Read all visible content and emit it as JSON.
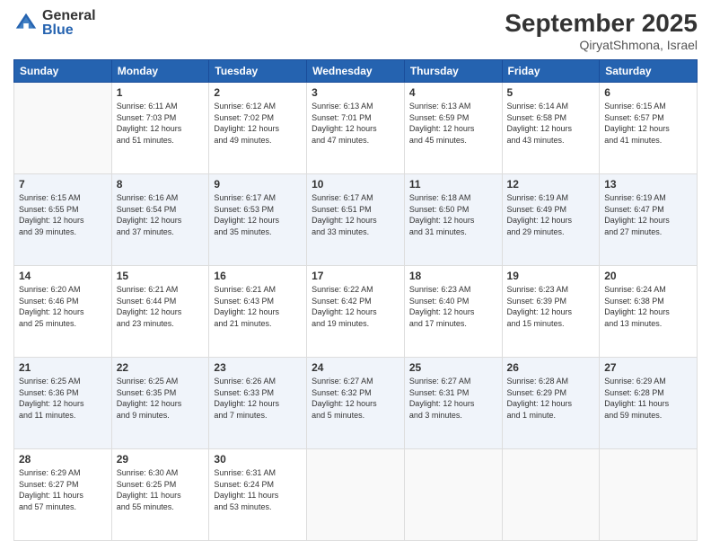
{
  "logo": {
    "general": "General",
    "blue": "Blue"
  },
  "title": "September 2025",
  "subtitle": "QiryatShmona, Israel",
  "days_header": [
    "Sunday",
    "Monday",
    "Tuesday",
    "Wednesday",
    "Thursday",
    "Friday",
    "Saturday"
  ],
  "weeks": [
    [
      {
        "day": "",
        "info": ""
      },
      {
        "day": "1",
        "info": "Sunrise: 6:11 AM\nSunset: 7:03 PM\nDaylight: 12 hours\nand 51 minutes."
      },
      {
        "day": "2",
        "info": "Sunrise: 6:12 AM\nSunset: 7:02 PM\nDaylight: 12 hours\nand 49 minutes."
      },
      {
        "day": "3",
        "info": "Sunrise: 6:13 AM\nSunset: 7:01 PM\nDaylight: 12 hours\nand 47 minutes."
      },
      {
        "day": "4",
        "info": "Sunrise: 6:13 AM\nSunset: 6:59 PM\nDaylight: 12 hours\nand 45 minutes."
      },
      {
        "day": "5",
        "info": "Sunrise: 6:14 AM\nSunset: 6:58 PM\nDaylight: 12 hours\nand 43 minutes."
      },
      {
        "day": "6",
        "info": "Sunrise: 6:15 AM\nSunset: 6:57 PM\nDaylight: 12 hours\nand 41 minutes."
      }
    ],
    [
      {
        "day": "7",
        "info": "Sunrise: 6:15 AM\nSunset: 6:55 PM\nDaylight: 12 hours\nand 39 minutes."
      },
      {
        "day": "8",
        "info": "Sunrise: 6:16 AM\nSunset: 6:54 PM\nDaylight: 12 hours\nand 37 minutes."
      },
      {
        "day": "9",
        "info": "Sunrise: 6:17 AM\nSunset: 6:53 PM\nDaylight: 12 hours\nand 35 minutes."
      },
      {
        "day": "10",
        "info": "Sunrise: 6:17 AM\nSunset: 6:51 PM\nDaylight: 12 hours\nand 33 minutes."
      },
      {
        "day": "11",
        "info": "Sunrise: 6:18 AM\nSunset: 6:50 PM\nDaylight: 12 hours\nand 31 minutes."
      },
      {
        "day": "12",
        "info": "Sunrise: 6:19 AM\nSunset: 6:49 PM\nDaylight: 12 hours\nand 29 minutes."
      },
      {
        "day": "13",
        "info": "Sunrise: 6:19 AM\nSunset: 6:47 PM\nDaylight: 12 hours\nand 27 minutes."
      }
    ],
    [
      {
        "day": "14",
        "info": "Sunrise: 6:20 AM\nSunset: 6:46 PM\nDaylight: 12 hours\nand 25 minutes."
      },
      {
        "day": "15",
        "info": "Sunrise: 6:21 AM\nSunset: 6:44 PM\nDaylight: 12 hours\nand 23 minutes."
      },
      {
        "day": "16",
        "info": "Sunrise: 6:21 AM\nSunset: 6:43 PM\nDaylight: 12 hours\nand 21 minutes."
      },
      {
        "day": "17",
        "info": "Sunrise: 6:22 AM\nSunset: 6:42 PM\nDaylight: 12 hours\nand 19 minutes."
      },
      {
        "day": "18",
        "info": "Sunrise: 6:23 AM\nSunset: 6:40 PM\nDaylight: 12 hours\nand 17 minutes."
      },
      {
        "day": "19",
        "info": "Sunrise: 6:23 AM\nSunset: 6:39 PM\nDaylight: 12 hours\nand 15 minutes."
      },
      {
        "day": "20",
        "info": "Sunrise: 6:24 AM\nSunset: 6:38 PM\nDaylight: 12 hours\nand 13 minutes."
      }
    ],
    [
      {
        "day": "21",
        "info": "Sunrise: 6:25 AM\nSunset: 6:36 PM\nDaylight: 12 hours\nand 11 minutes."
      },
      {
        "day": "22",
        "info": "Sunrise: 6:25 AM\nSunset: 6:35 PM\nDaylight: 12 hours\nand 9 minutes."
      },
      {
        "day": "23",
        "info": "Sunrise: 6:26 AM\nSunset: 6:33 PM\nDaylight: 12 hours\nand 7 minutes."
      },
      {
        "day": "24",
        "info": "Sunrise: 6:27 AM\nSunset: 6:32 PM\nDaylight: 12 hours\nand 5 minutes."
      },
      {
        "day": "25",
        "info": "Sunrise: 6:27 AM\nSunset: 6:31 PM\nDaylight: 12 hours\nand 3 minutes."
      },
      {
        "day": "26",
        "info": "Sunrise: 6:28 AM\nSunset: 6:29 PM\nDaylight: 12 hours\nand 1 minute."
      },
      {
        "day": "27",
        "info": "Sunrise: 6:29 AM\nSunset: 6:28 PM\nDaylight: 11 hours\nand 59 minutes."
      }
    ],
    [
      {
        "day": "28",
        "info": "Sunrise: 6:29 AM\nSunset: 6:27 PM\nDaylight: 11 hours\nand 57 minutes."
      },
      {
        "day": "29",
        "info": "Sunrise: 6:30 AM\nSunset: 6:25 PM\nDaylight: 11 hours\nand 55 minutes."
      },
      {
        "day": "30",
        "info": "Sunrise: 6:31 AM\nSunset: 6:24 PM\nDaylight: 11 hours\nand 53 minutes."
      },
      {
        "day": "",
        "info": ""
      },
      {
        "day": "",
        "info": ""
      },
      {
        "day": "",
        "info": ""
      },
      {
        "day": "",
        "info": ""
      }
    ]
  ]
}
